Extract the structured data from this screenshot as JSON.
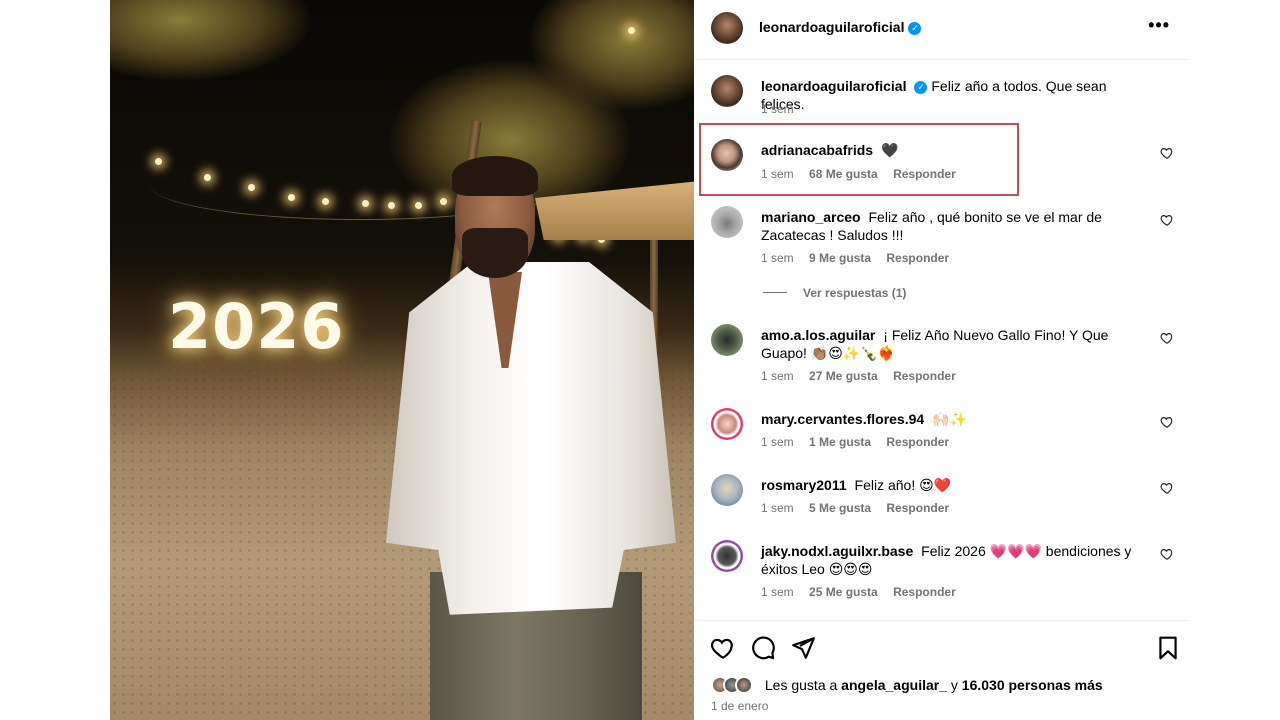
{
  "post": {
    "photo_sign_text": "2026"
  },
  "header": {
    "username": "leonardoaguilaroficial",
    "verified_mark": "✓",
    "more_label": "•••"
  },
  "caption": {
    "username": "leonardoaguilaroficial",
    "text": "Feliz año a todos. Que sean felices.",
    "time": "1 sem"
  },
  "comments": [
    {
      "username": "adrianacabafrids",
      "text": "🖤",
      "time": "1 sem",
      "likes": "68 Me gusta",
      "reply": "Responder"
    },
    {
      "username": "mariano_arceo",
      "text": "Feliz año , qué bonito se ve el mar de Zacatecas ! Saludos !!!",
      "time": "1 sem",
      "likes": "9 Me gusta",
      "reply": "Responder"
    },
    {
      "username": "amo.a.los.aguilar",
      "text": "¡ Feliz Año Nuevo Gallo Fino! Y Que Guapo! 👏🏽😍✨🍾❤️‍🔥",
      "time": "1 sem",
      "likes": "27 Me gusta",
      "reply": "Responder"
    },
    {
      "username": "mary.cervantes.flores.94",
      "text": "🙌🏻✨",
      "time": "1 sem",
      "likes": "1 Me gusta",
      "reply": "Responder"
    },
    {
      "username": "rosmary2011",
      "text": "Feliz año! 😍❤️",
      "time": "1 sem",
      "likes": "5 Me gusta",
      "reply": "Responder"
    },
    {
      "username": "jaky.nodxl.aguilxr.base",
      "text": "Feliz 2026 💗💗💗 bendiciones y éxitos Leo 😍😍😍",
      "time": "1 sem",
      "likes": "25 Me gusta",
      "reply": "Responder"
    }
  ],
  "view_replies": "Ver respuestas (1)",
  "likes_summary": {
    "prefix": "Les gusta a",
    "user": "angela_aguilar_",
    "middle": "y",
    "count": "16.030 personas más"
  },
  "date": "1 de enero",
  "icons": {
    "like": "heart-icon",
    "comment": "comment-icon",
    "share": "share-icon",
    "save": "bookmark-icon",
    "more": "more-icon"
  },
  "colors": {
    "verified": "#0095f6",
    "meta_text": "#737373",
    "highlight_box": "#c0504d"
  }
}
